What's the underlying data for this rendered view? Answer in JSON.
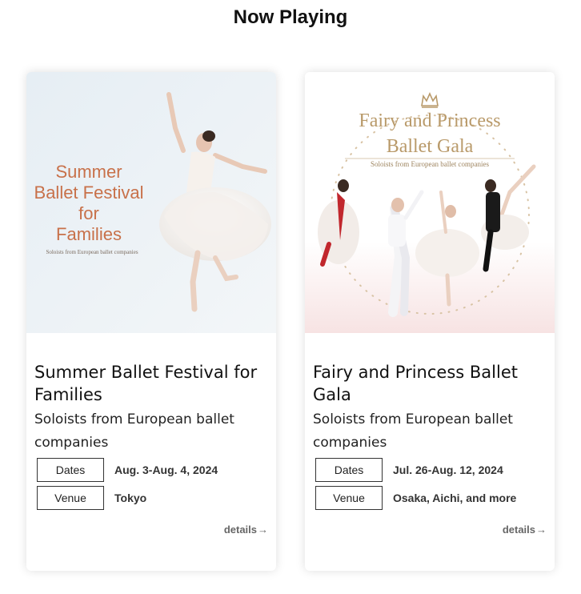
{
  "page": {
    "title": "Now Playing"
  },
  "events": [
    {
      "image": {
        "title_lines": [
          "Summer",
          "Ballet Festival",
          "for",
          "Families"
        ],
        "tagline": "Soloists from European ballet companies",
        "title_color": "#c8714a",
        "background": "#e9f1f6"
      },
      "title": "Summer Ballet Festival for Families",
      "subtitle": "Soloists from European ballet companies",
      "dates_label": "Dates",
      "dates": "Aug. 3-Aug. 4, 2024",
      "venue_label": "Venue",
      "venue": "Tokyo",
      "details_label": "details",
      "details_arrow": "→"
    },
    {
      "image": {
        "title_lines": [
          "Fairy and Princess",
          "Ballet Gala"
        ],
        "tagline": "Soloists from European ballet companies",
        "title_color": "#b99a6a",
        "background": "#ffffff"
      },
      "title": "Fairy and Princess Ballet Gala",
      "subtitle": "Soloists from European ballet companies",
      "dates_label": "Dates",
      "dates": "Jul. 26-Aug. 12, 2024",
      "venue_label": "Venue",
      "venue": "Osaka, Aichi, and more",
      "details_label": "details",
      "details_arrow": "→"
    }
  ]
}
